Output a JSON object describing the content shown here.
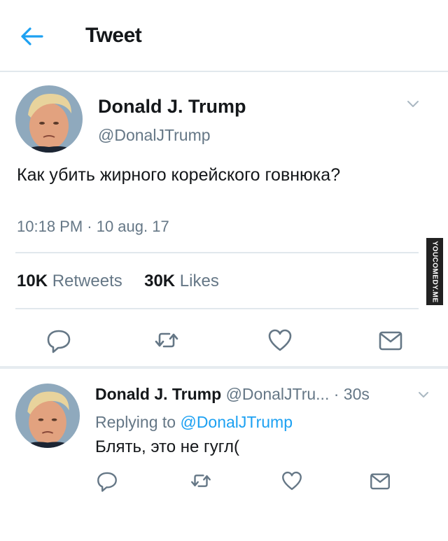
{
  "header": {
    "title": "Tweet",
    "back_icon": "arrow-left-icon"
  },
  "tweet": {
    "author_name": "Donald J. Trump",
    "author_handle": "@DonalJTrump",
    "text": "Как убить жирного корейского говнюка?",
    "time": "10:18 PM · 10 aug. 17",
    "retweets_count": "10K",
    "retweets_label": "Retweets",
    "likes_count": "30K",
    "likes_label": "Likes"
  },
  "reply": {
    "author_name": "Donald J. Trump",
    "author_handle": "@DonalJTru...",
    "time": "· 30s",
    "replying_prefix": "Replying to",
    "replying_to": "@DonalJTrump",
    "text": "Блять, это не гугл("
  },
  "watermark": "YOUCOMEDY.ME",
  "colors": {
    "accent": "#1da1f2",
    "secondary_text": "#657786",
    "divider": "#e1e8ed",
    "icon": "#657786"
  },
  "icons": [
    "reply-icon",
    "retweet-icon",
    "like-icon",
    "share-icon",
    "chevron-down-icon"
  ]
}
